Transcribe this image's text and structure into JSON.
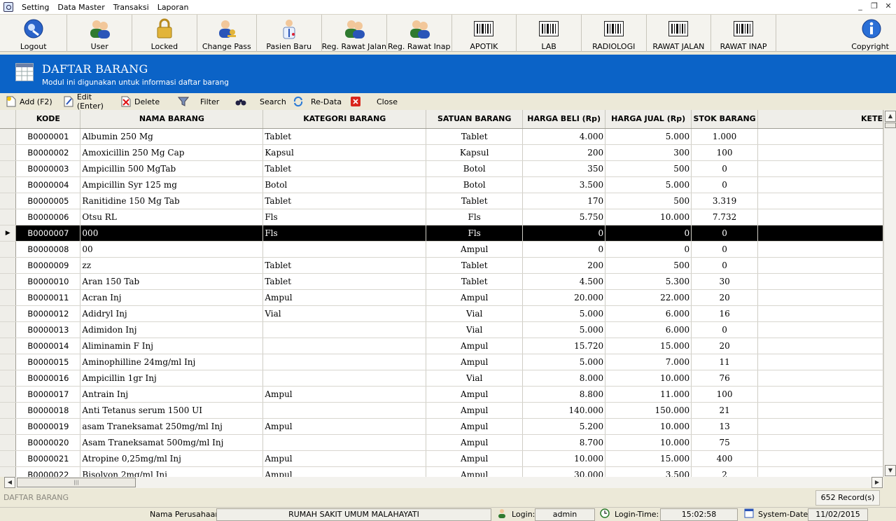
{
  "menu": {
    "items": [
      "Setting",
      "Data Master",
      "Transaksi",
      "Laporan"
    ]
  },
  "window_controls": {
    "minimize": "_",
    "restore": "❐",
    "close": "✕"
  },
  "toolbar": {
    "buttons": [
      {
        "label": "Logout",
        "icon": "logout-icon"
      },
      {
        "label": "User",
        "icon": "user-icon"
      },
      {
        "label": "Locked",
        "icon": "lock-icon"
      },
      {
        "label": "Change Pass",
        "icon": "change-pass-icon"
      },
      {
        "label": "Pasien Baru",
        "icon": "doctor-icon"
      },
      {
        "label": "Reg. Rawat Jalan",
        "icon": "users-icon"
      },
      {
        "label": "Reg. Rawat Inap",
        "icon": "users-icon"
      },
      {
        "label": "APOTIK",
        "icon": "barcode-icon"
      },
      {
        "label": "LAB",
        "icon": "barcode-icon"
      },
      {
        "label": "RADIOLOGI",
        "icon": "barcode-icon"
      },
      {
        "label": "RAWAT JALAN",
        "icon": "barcode-icon"
      },
      {
        "label": "RAWAT INAP",
        "icon": "barcode-icon"
      },
      {
        "label": "Copyright",
        "icon": "info-icon"
      }
    ]
  },
  "banner": {
    "title": "DAFTAR BARANG",
    "subtitle": "Modul ini digunakan untuk informasi daftar barang"
  },
  "actions": {
    "add": "Add (F2)",
    "edit": "Edit (Enter)",
    "delete": "Delete",
    "filter": "Filter",
    "search": "Search",
    "redata": "Re-Data",
    "close": "Close"
  },
  "grid": {
    "columns": [
      "KODE",
      "NAMA BARANG",
      "KATEGORI BARANG",
      "SATUAN BARANG",
      "HARGA BELI (Rp)",
      "HARGA JUAL (Rp)",
      "STOK BARANG",
      "KETE"
    ],
    "selected_index": 6,
    "rows": [
      [
        "B0000001",
        "Albumin 250 Mg",
        "Tablet",
        "Tablet",
        "4.000",
        "5.000",
        "1.000"
      ],
      [
        "B0000002",
        "Amoxicillin 250 Mg Cap",
        "Kapsul",
        "Kapsul",
        "200",
        "300",
        "100"
      ],
      [
        "B0000003",
        "Ampicillin 500 MgTab",
        "Tablet",
        "Botol",
        "350",
        "500",
        "0"
      ],
      [
        "B0000004",
        "Ampicillin Syr 125 mg",
        "Botol",
        "Botol",
        "3.500",
        "5.000",
        "0"
      ],
      [
        "B0000005",
        "Ranitidine 150 Mg Tab",
        "Tablet",
        "Tablet",
        "170",
        "500",
        "3.319"
      ],
      [
        "B0000006",
        "Otsu RL",
        "Fls",
        "Fls",
        "5.750",
        "10.000",
        "7.732"
      ],
      [
        "B0000007",
        "000",
        "Fls",
        "Fls",
        "0",
        "0",
        "0"
      ],
      [
        "B0000008",
        "00",
        "",
        "Ampul",
        "0",
        "0",
        "0"
      ],
      [
        "B0000009",
        "zz",
        "Tablet",
        "Tablet",
        "200",
        "500",
        "0"
      ],
      [
        "B0000010",
        "Aran 150 Tab",
        "Tablet",
        "Tablet",
        "4.500",
        "5.300",
        "30"
      ],
      [
        "B0000011",
        "Acran Inj",
        "Ampul",
        "Ampul",
        "20.000",
        "22.000",
        "20"
      ],
      [
        "B0000012",
        "Adidryl Inj",
        "Vial",
        "Vial",
        "5.000",
        "6.000",
        "16"
      ],
      [
        "B0000013",
        "Adimidon Inj",
        "",
        "Vial",
        "5.000",
        "6.000",
        "0"
      ],
      [
        "B0000014",
        "Aliminamin F  Inj",
        "",
        "Ampul",
        "15.720",
        "15.000",
        "20"
      ],
      [
        "B0000015",
        "Aminophilline 24mg/ml  Inj",
        "",
        "Ampul",
        "5.000",
        "7.000",
        "11"
      ],
      [
        "B0000016",
        "Ampicillin 1gr Inj",
        "",
        "Vial",
        "8.000",
        "10.000",
        "76"
      ],
      [
        "B0000017",
        "Antrain  Inj",
        "Ampul",
        "Ampul",
        "8.800",
        "11.000",
        "100"
      ],
      [
        "B0000018",
        "Anti Tetanus serum 1500 UI",
        "",
        "Ampul",
        "140.000",
        "150.000",
        "21"
      ],
      [
        "B0000019",
        "asam Traneksamat 250mg/ml Inj",
        "Ampul",
        "Ampul",
        "5.200",
        "10.000",
        "13"
      ],
      [
        "B0000020",
        "Asam Traneksamat 500mg/ml Inj",
        "",
        "Ampul",
        "8.700",
        "10.000",
        "75"
      ],
      [
        "B0000021",
        "Atropine 0,25mg/ml Inj",
        "Ampul",
        "Ampul",
        "10.000",
        "15.000",
        "400"
      ],
      [
        "B0000022",
        "Bisolvon 2mg/ml Inj",
        "Ampul",
        "Ampul",
        "30.000",
        "3.500",
        "2"
      ]
    ]
  },
  "status": {
    "module": "DAFTAR BARANG",
    "records": "652 Record(s)",
    "company_label": "Nama Perusahaan",
    "company_value": "RUMAH SAKIT UMUM MALAHAYATI",
    "login_label": "Login:",
    "login_value": "admin",
    "login_time_label": "Login-Time:",
    "login_time_value": "15:02:58",
    "system_date_label": "System-Date:",
    "system_date_value": "11/02/2015"
  },
  "colors": {
    "banner": "#0b63c7",
    "selected_row": "#000000"
  }
}
